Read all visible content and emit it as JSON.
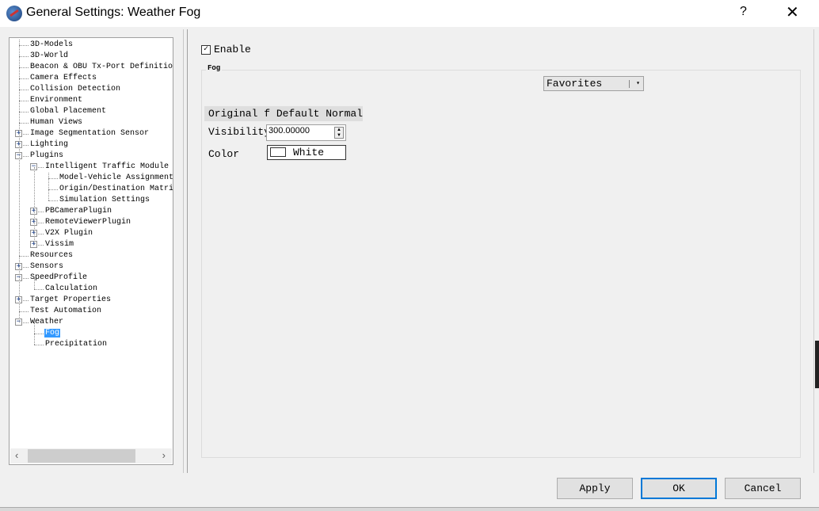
{
  "window": {
    "title": "General Settings: Weather Fog",
    "help_label": "?",
    "close_label": "✕",
    "icon": "app-globe-icon"
  },
  "tree": {
    "items": [
      {
        "label": "3D-Models",
        "level": 0,
        "expander": null
      },
      {
        "label": "3D-World",
        "level": 0,
        "expander": null
      },
      {
        "label": "Beacon & OBU Tx-Port Definitio",
        "level": 0,
        "expander": null
      },
      {
        "label": "Camera Effects",
        "level": 0,
        "expander": null
      },
      {
        "label": "Collision Detection",
        "level": 0,
        "expander": null
      },
      {
        "label": "Environment",
        "level": 0,
        "expander": null
      },
      {
        "label": "Global Placement",
        "level": 0,
        "expander": null
      },
      {
        "label": "Human Views",
        "level": 0,
        "expander": null
      },
      {
        "label": "Image Segmentation Sensor",
        "level": 0,
        "expander": "+"
      },
      {
        "label": "Lighting",
        "level": 0,
        "expander": "+"
      },
      {
        "label": "Plugins",
        "level": 0,
        "expander": "-"
      },
      {
        "label": "Intelligent Traffic Module",
        "level": 1,
        "expander": "-"
      },
      {
        "label": "Model-Vehicle Assignment",
        "level": 2,
        "expander": null
      },
      {
        "label": "Origin/Destination Matri",
        "level": 2,
        "expander": null
      },
      {
        "label": "Simulation Settings",
        "level": 2,
        "expander": null
      },
      {
        "label": "PBCameraPlugin",
        "level": 1,
        "expander": "+"
      },
      {
        "label": "RemoteViewerPlugin",
        "level": 1,
        "expander": "+"
      },
      {
        "label": "V2X Plugin",
        "level": 1,
        "expander": "+"
      },
      {
        "label": "Vissim",
        "level": 1,
        "expander": "+"
      },
      {
        "label": "Resources",
        "level": 0,
        "expander": null
      },
      {
        "label": "Sensors",
        "level": 0,
        "expander": "+"
      },
      {
        "label": "SpeedProfile",
        "level": 0,
        "expander": "-"
      },
      {
        "label": "Calculation",
        "level": 1,
        "expander": null
      },
      {
        "label": "Target Properties",
        "level": 0,
        "expander": "+"
      },
      {
        "label": "Test Automation",
        "level": 0,
        "expander": null
      },
      {
        "label": "Weather",
        "level": 0,
        "expander": "-"
      },
      {
        "label": "Fog",
        "level": 1,
        "expander": null,
        "selected": true
      },
      {
        "label": "Precipitation",
        "level": 1,
        "expander": null
      }
    ],
    "scroll_left": "‹",
    "scroll_right": "›"
  },
  "settings": {
    "enable_label": "Enable",
    "enable_checked": true,
    "group_label": "Fog",
    "favorites": {
      "value": "Favorites",
      "arrow": "▾"
    },
    "header_text": "Original f Default Normal",
    "visibility": {
      "label": "Visibility",
      "value": "300.00000"
    },
    "color": {
      "label": "Color",
      "value": "White",
      "swatch": "#ffffff"
    }
  },
  "buttons": {
    "apply": "Apply",
    "ok": "OK",
    "cancel": "Cancel"
  },
  "colors": {
    "selection": "#3399ff",
    "default_button_border": "#0078d7"
  }
}
